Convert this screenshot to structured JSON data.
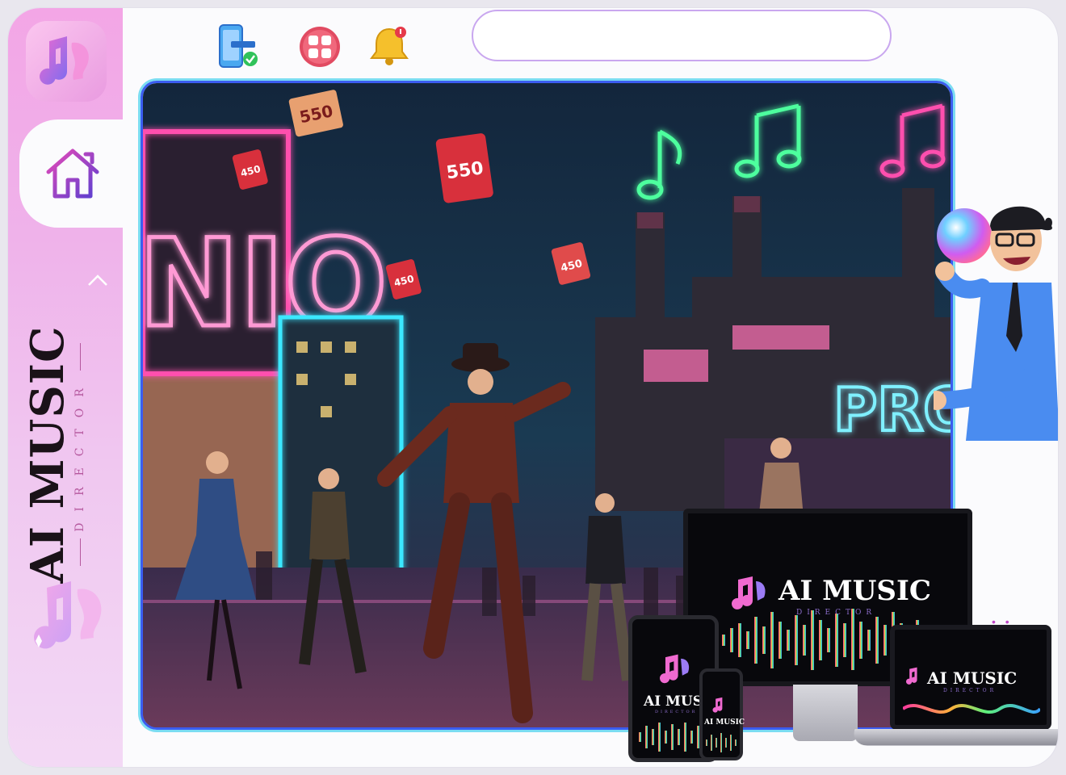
{
  "sidebar": {
    "logo_icon": "music-note-logo-icon",
    "home_icon": "home-icon",
    "collapse_icon": "chevron-up-icon",
    "brand": {
      "title": "AI MUSIC",
      "subtitle": "DIRECTOR"
    }
  },
  "topbar": {
    "icons": [
      "mobile-check-icon",
      "grid-apps-icon",
      "notification-bell-icon"
    ],
    "search": {
      "placeholder": "",
      "value": ""
    }
  },
  "hero": {
    "signs": {
      "left": "NIO",
      "right": "PRON"
    },
    "price_tags": [
      "550",
      "550",
      "450",
      "450",
      "450"
    ]
  },
  "mockups": {
    "monitor": {
      "title": "AI MUSIC",
      "subtitle": "DIRECTOR"
    },
    "laptop": {
      "title": "AI MUSIC",
      "subtitle": "DIRECTOR"
    },
    "tablet": {
      "title": "AI MUSI",
      "subtitle": "DIRECTOR"
    },
    "phone": {
      "title": "AI MUSIC"
    }
  },
  "colors": {
    "accent_pink": "#ec4fc4",
    "accent_purple": "#8b4fd8",
    "hero_border": "#3b5df0",
    "neon_cyan": "#3be8ff",
    "neon_green": "#4dff9e"
  }
}
